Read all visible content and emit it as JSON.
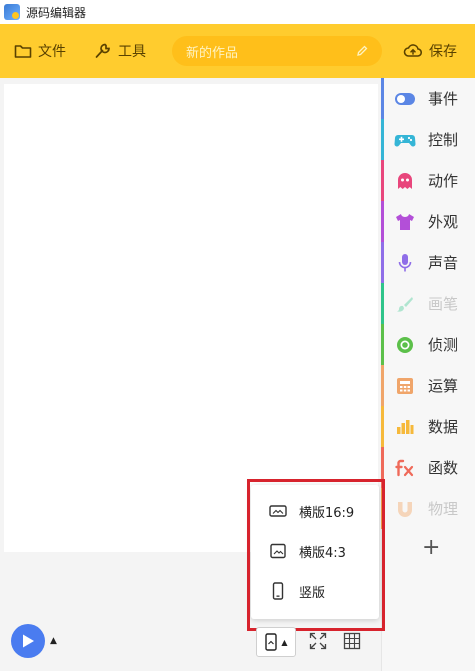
{
  "window": {
    "title": "源码编辑器"
  },
  "toolbar": {
    "file_label": "文件",
    "tools_label": "工具",
    "project_name": "新的作品",
    "save_label": "保存"
  },
  "categories": [
    {
      "label": "事件",
      "color": "#5b86e5",
      "icon": "toggle-icon",
      "dim": false
    },
    {
      "label": "控制",
      "color": "#35b5d6",
      "icon": "gamepad-icon",
      "dim": false
    },
    {
      "label": "动作",
      "color": "#e8467c",
      "icon": "ghost-icon",
      "dim": false
    },
    {
      "label": "外观",
      "color": "#b34fd8",
      "icon": "tshirt-icon",
      "dim": false
    },
    {
      "label": "声音",
      "color": "#8f6ee8",
      "icon": "microphone-icon",
      "dim": false
    },
    {
      "label": "画笔",
      "color": "#2fc48a",
      "icon": "brush-icon",
      "dim": true
    },
    {
      "label": "侦测",
      "color": "#5cc04a",
      "icon": "radar-icon",
      "dim": false
    },
    {
      "label": "运算",
      "color": "#f0a56a",
      "icon": "calculator-icon",
      "dim": false
    },
    {
      "label": "数据",
      "color": "#f6b93b",
      "icon": "bar-chart-icon",
      "dim": false
    },
    {
      "label": "函数",
      "color": "#ef6a5a",
      "icon": "function-icon",
      "dim": false
    },
    {
      "label": "物理",
      "color": "#f2994a",
      "icon": "magnet-icon",
      "dim": true
    }
  ],
  "layout_menu": {
    "items": [
      {
        "label": "横版16:9",
        "icon": "landscape-wide-icon"
      },
      {
        "label": "横版4:3",
        "icon": "landscape-icon"
      },
      {
        "label": "竖版",
        "icon": "portrait-icon"
      }
    ]
  },
  "controls": {
    "play_caret": "▲",
    "layout_caret": "▲",
    "add_category": "+"
  },
  "colors": {
    "toolbar": "#ffcc2e",
    "accent_blue": "#4a7cf0",
    "highlight": "#d7232d"
  }
}
